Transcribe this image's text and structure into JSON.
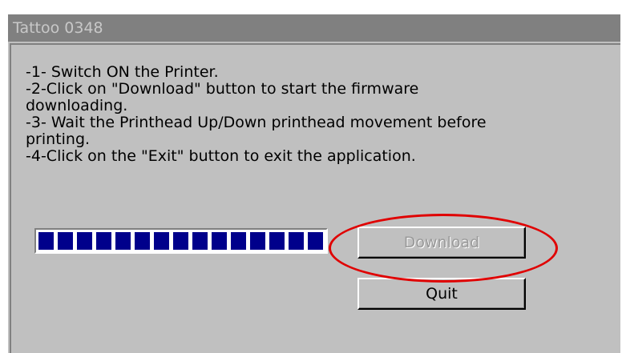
{
  "window": {
    "title": "Tattoo 0348"
  },
  "instructions": [
    "-1- Switch ON the Printer.",
    "-2-Click on \"Download\" button to start the firmware",
    "downloading.",
    "-3- Wait the Printhead Up/Down printhead movement before",
    "printing.",
    "-4-Click on the \"Exit\" button to exit the application."
  ],
  "progress": {
    "value": 1.0,
    "segment_color": "#00008b"
  },
  "buttons": {
    "download_label": "Download",
    "download_enabled": false,
    "quit_label": "Quit"
  },
  "annotation": {
    "color": "#e00000"
  }
}
